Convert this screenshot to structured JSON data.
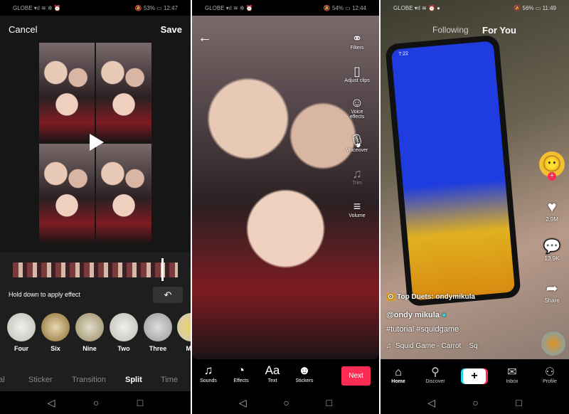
{
  "panel1": {
    "status": {
      "left": "GLOBE ▾ıl ≋ ✲ ⏰",
      "battery": "53%",
      "time": "12:47"
    },
    "cancel": "Cancel",
    "save": "Save",
    "hint": "Hold down to apply effect",
    "effects": [
      {
        "label": "Four"
      },
      {
        "label": "Six"
      },
      {
        "label": "Nine"
      },
      {
        "label": "Two"
      },
      {
        "label": "Three"
      },
      {
        "label": "Mix"
      }
    ],
    "tabs": [
      {
        "label": "ual"
      },
      {
        "label": "Sticker"
      },
      {
        "label": "Transition"
      },
      {
        "label": "Split"
      },
      {
        "label": "Time"
      }
    ],
    "active_tab": "Split"
  },
  "panel2": {
    "status": {
      "left": "GLOBE ▾ıl ≋ ✲ ⏰",
      "battery": "54%",
      "time": "12:44"
    },
    "rail": [
      {
        "label": "Filters",
        "icon": "filters-icon"
      },
      {
        "label": "Adjust clips",
        "icon": "adjust-clips-icon"
      },
      {
        "label": "Voice effects",
        "icon": "voice-effects-icon"
      },
      {
        "label": "Voiceover",
        "icon": "microphone-icon"
      },
      {
        "label": "Trim",
        "icon": "music-trim-icon"
      },
      {
        "label": "Volume",
        "icon": "volume-sliders-icon"
      }
    ],
    "tools": [
      {
        "label": "Sounds"
      },
      {
        "label": "Effects"
      },
      {
        "label": "Text"
      },
      {
        "label": "Stickers"
      }
    ],
    "next": "Next"
  },
  "panel3": {
    "status": {
      "left": "GLOBE ▾ıl ≋ ⏰ ●",
      "battery": "56%",
      "time": "11:49"
    },
    "following": "Following",
    "for_you": "For You",
    "likes": "2.9M",
    "comments": "13.9K",
    "share": "Share",
    "top_duets": "Top Duets: ondymikula",
    "username": "@ondy mikula",
    "hashtags": "#tutorial #squidgame",
    "sound": "Squid Game - Carrot    Sq",
    "phone_time": "7:22",
    "nav": [
      {
        "label": "Home"
      },
      {
        "label": "Discover"
      },
      {
        "label": "+"
      },
      {
        "label": "Inbox"
      },
      {
        "label": "Profile"
      }
    ]
  },
  "colors": {
    "accent": "#fe2c55",
    "bg": "#121212"
  }
}
